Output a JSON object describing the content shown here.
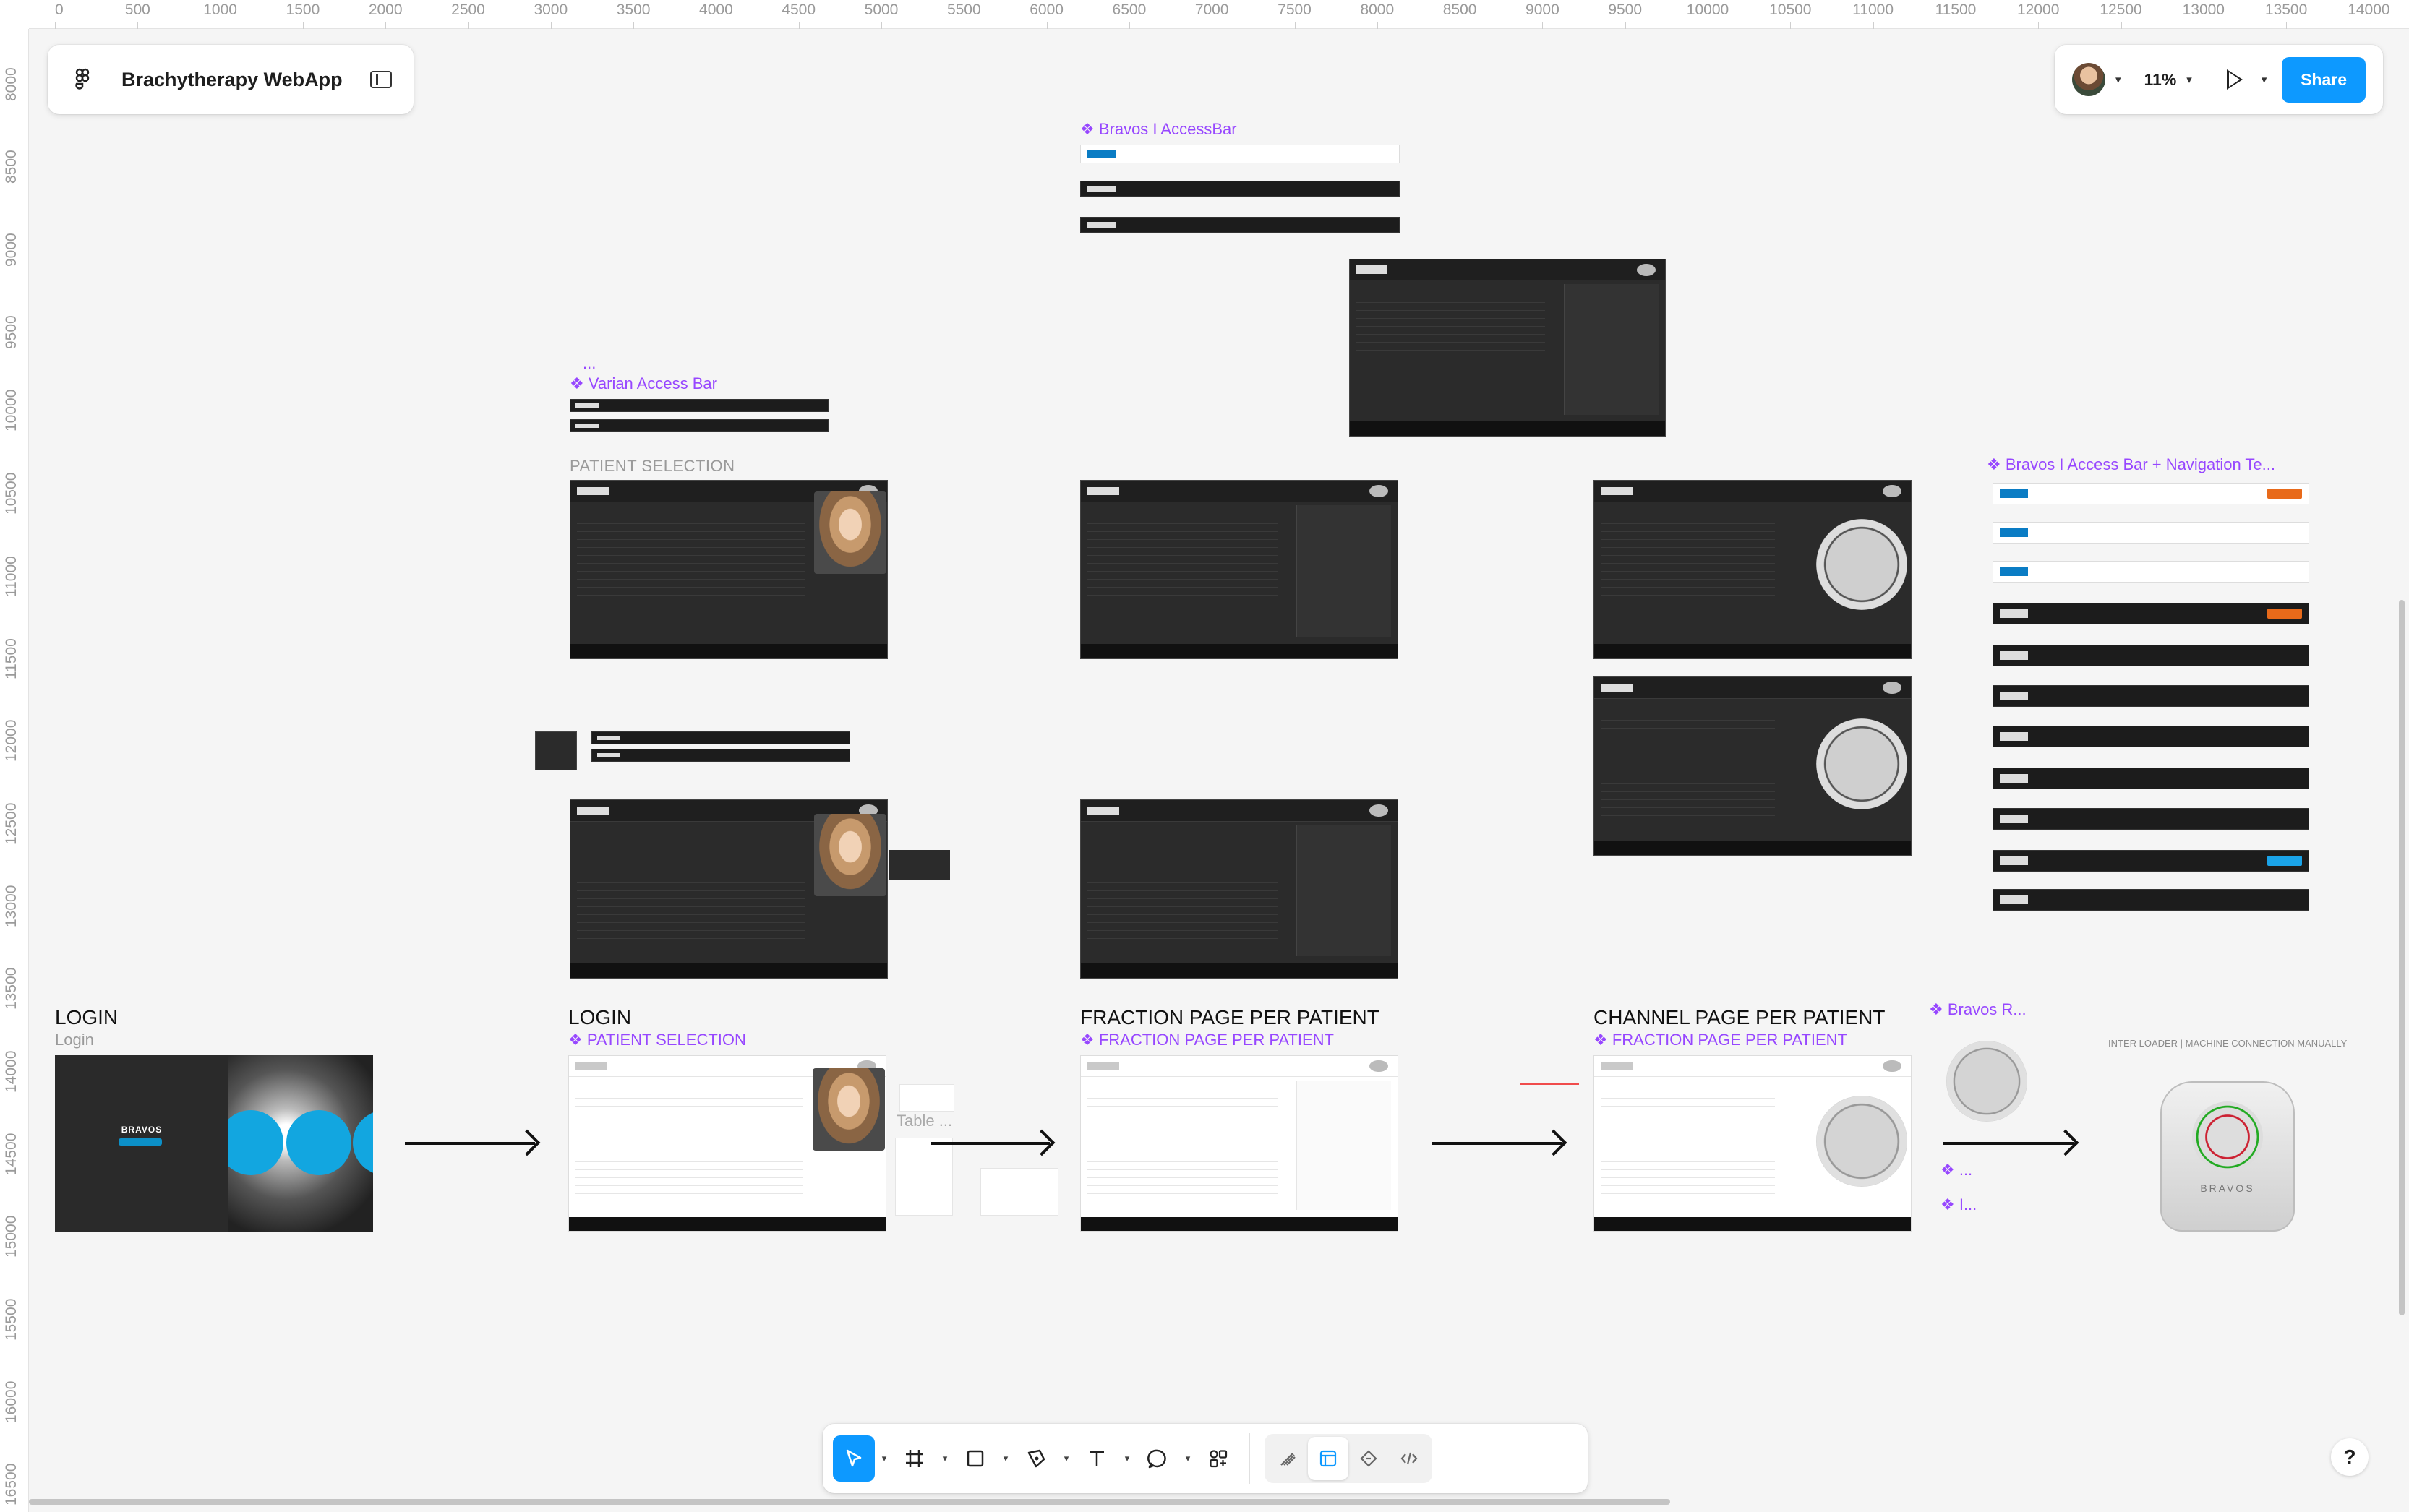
{
  "app": {
    "title": "Brachytherapy WebApp",
    "zoom": "11%",
    "share_label": "Share"
  },
  "ruler": {
    "top": [
      "0",
      "500",
      "1000",
      "1500",
      "2000",
      "2500",
      "3000",
      "3500",
      "4000",
      "4500",
      "5000",
      "5500",
      "6000",
      "6500",
      "7000",
      "7500",
      "8000",
      "8500",
      "9000",
      "9500",
      "10000",
      "10500",
      "11000",
      "11500",
      "12000",
      "12500",
      "13000",
      "13500",
      "14000"
    ],
    "left": [
      "8000",
      "8500",
      "9000",
      "9500",
      "10000",
      "10500",
      "11000",
      "11500",
      "12000",
      "12500",
      "13000",
      "13500",
      "14000",
      "14500",
      "15000",
      "15500",
      "16000",
      "16500"
    ]
  },
  "labels": {
    "bravos_access_bar": "❖ Bravos I AccessBar",
    "varian_access_bar": "❖ Varian Access Bar",
    "patient_selection_top": "PATIENT SELECTION",
    "bravos_access_nav": "❖ Bravos I Access Bar + Navigation Te...",
    "dots": "...",
    "login": "LOGIN",
    "login_sub": "Login",
    "login2": "LOGIN",
    "patient_selection_comp": "❖ PATIENT SELECTION",
    "fraction_page": "FRACTION PAGE PER PATIENT",
    "fraction_page_comp": "❖ FRACTION PAGE PER PATIENT",
    "channel_page": "CHANNEL PAGE PER PATIENT",
    "channel_page_comp": "❖ FRACTION PAGE PER PATIENT",
    "bravos_r": "❖ Bravos R...",
    "inter_loader": "INTER LOADER | MACHINE CONNECTION MANUALLY",
    "table_label": "Table ...",
    "purple_item1": "❖ ...",
    "purple_item2": "❖ I...",
    "login_brand": "BRAVOS",
    "machine_brand": "BRAVOS"
  },
  "toolbar": {
    "tools": [
      "move-tool",
      "frame-tool",
      "shape-tool",
      "pen-tool",
      "text-tool",
      "comment-tool",
      "actions-tool"
    ],
    "modes": [
      "draw-mode",
      "design-mode",
      "prototype-mode",
      "dev-mode"
    ]
  },
  "help": "?"
}
